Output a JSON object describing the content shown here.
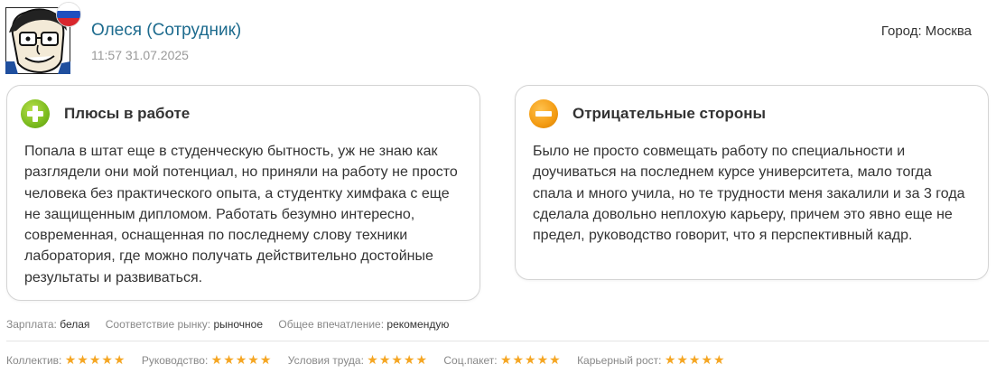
{
  "author": {
    "name": "Олеся (Сотрудник)",
    "date": "11:57 31.07.2025",
    "city_label": "Город: Москва",
    "flag_colors": [
      "#ffffff",
      "#1f4fbf",
      "#d8262d"
    ]
  },
  "pros": {
    "icon": "plus-icon",
    "title": "Плюсы в работе",
    "text": "Попала в штат еще в студенческую бытность, уж не знаю как разглядели они мой потенциал, но приняли на работу не просто человека без практического опыта, а студентку химфака с еще не защищенным дипломом. Работать безумно интересно, современная, оснащенная по последнему слову техники лаборатория, где можно получать действительно достойные результаты и развиваться."
  },
  "cons": {
    "icon": "minus-icon",
    "title": "Отрицательные стороны",
    "text": "Было не просто совмещать работу по специальности и доучиваться на последнем курсе университета, мало тогда спала и много учила, но те трудности меня закалили и за 3 года сделала довольно неплохую карьеру, причем это явно еще не предел, руководство говорит, что я перспективный кадр."
  },
  "stats": [
    {
      "label": "Зарплата:",
      "value": "белая"
    },
    {
      "label": "Соответствие рынку:",
      "value": "рыночное"
    },
    {
      "label": "Общее впечатление:",
      "value": "рекомендую"
    }
  ],
  "ratings": [
    {
      "label": "Коллектив:",
      "stars": 5,
      "stars_text": "★★★★★"
    },
    {
      "label": "Руководство:",
      "stars": 5,
      "stars_text": "★★★★★"
    },
    {
      "label": "Условия труда:",
      "stars": 5,
      "stars_text": "★★★★★"
    },
    {
      "label": "Соц.пакет:",
      "stars": 5,
      "stars_text": "★★★★★"
    },
    {
      "label": "Карьерный рост:",
      "stars": 5,
      "stars_text": "★★★★★"
    }
  ],
  "colors": {
    "accent": "#1d6b8e",
    "pros_icon": "#7bbb1e",
    "cons_icon": "#f39b12",
    "star": "#f5a623"
  }
}
